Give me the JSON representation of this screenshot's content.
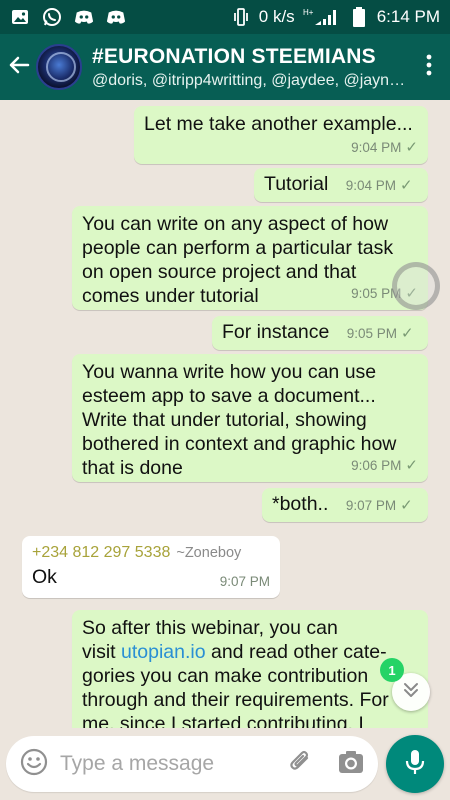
{
  "status_bar": {
    "speed": "0 k/s",
    "network": "H+",
    "battery": "",
    "time": "6:14 PM",
    "icons": [
      "image-icon",
      "whatsapp-icon",
      "discord-icon",
      "discord-icon",
      "vibrate-icon",
      "wifi-icon",
      "signal-icon",
      "battery-icon"
    ]
  },
  "header": {
    "back_icon": "back-arrow-icon",
    "title": "#EURONATION STEEMIANS",
    "members": "@doris, @itripp4writting, @jaydee, @jayne…",
    "menu_icon": "overflow-menu-icon"
  },
  "messages": [
    {
      "dir": "out",
      "text": "Let me take another example...",
      "time": "9:04 PM"
    },
    {
      "dir": "out",
      "text": "Tutorial",
      "time": "9:04 PM"
    },
    {
      "dir": "out",
      "lines": [
        "You can write on any aspect of how",
        "people can perform a particular task",
        "on open source project and that",
        "comes under tutorial"
      ],
      "time": "9:05 PM"
    },
    {
      "dir": "out",
      "text": "For instance",
      "time": "9:05 PM"
    },
    {
      "dir": "out",
      "lines": [
        "You wanna write how you can use",
        "esteem app to save a document...",
        "Write that under tutorial, showing",
        "bothered in context and graphic how",
        "that is done"
      ],
      "time": "9:06 PM"
    },
    {
      "dir": "out",
      "text": "*both..",
      "time": "9:07 PM"
    },
    {
      "dir": "in",
      "sender_phone": "+234 812 297 5338",
      "sender_name": "~Zoneboy",
      "text": "Ok",
      "time": "9:07 PM"
    },
    {
      "dir": "out",
      "lines_before": [
        "So after this webinar, you can"
      ],
      "line_link_prefix": "visit ",
      "link": "utopian.io",
      "line_link_suffix": " and read other cate-",
      "lines_after": [
        "gories you can make contribution",
        "through and their requirements. For",
        "me, since I started contributing, I"
      ]
    }
  ],
  "scroll_badge": {
    "count": "1",
    "icon": "double-chevron-down-icon"
  },
  "input": {
    "placeholder": "Type a message",
    "value": "",
    "emoji_icon": "emoji-icon",
    "attach_icon": "attachment-icon",
    "camera_icon": "camera-icon",
    "mic_icon": "microphone-icon"
  },
  "colors": {
    "header": "#075e54",
    "status_bar": "#054d44",
    "outgoing_bubble": "#dcf8c6",
    "incoming_bubble": "#ffffff",
    "chat_background": "#ece5dd",
    "mic_button": "#00897b",
    "link": "#2a8fd4",
    "sender_phone": "#a8a33a"
  }
}
